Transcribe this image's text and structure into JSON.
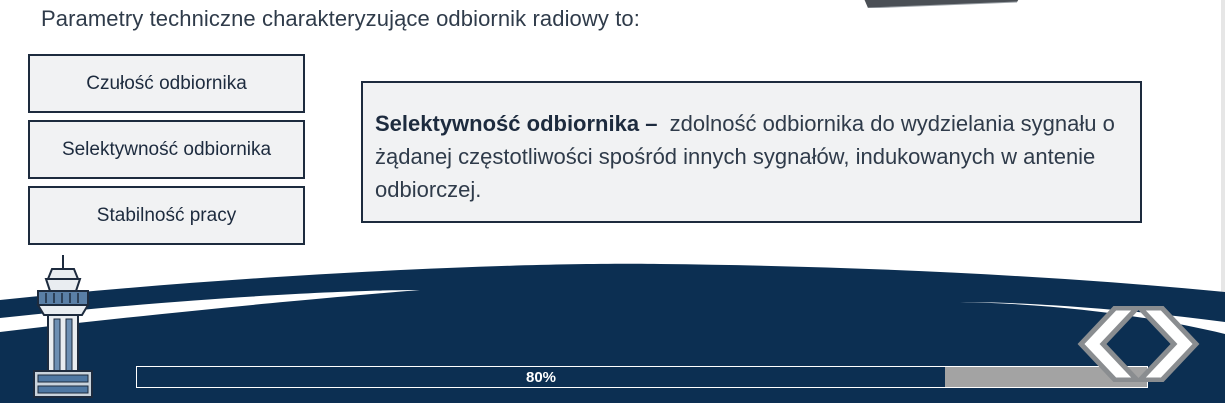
{
  "intro": {
    "text": "Parametry techniczne charakteryzujące odbiornik radiowy to:"
  },
  "options": [
    {
      "label": "Czułość odbiornika"
    },
    {
      "label": "Selektywność odbiornika"
    },
    {
      "label": "Stabilność pracy"
    }
  ],
  "selected_option": "Selektywność odbiornika",
  "description": {
    "term": "Selektywność odbiornika –",
    "text": "zdolność odbiornika do wydzielania sygnału o żądanej częstotliwości spośród innych sygnałów, indukowanych w antenie odbiorczej."
  },
  "progress": {
    "value": 0.8,
    "label": "80%"
  },
  "navigation": {
    "prev_icon": "chevron-left-icon",
    "next_icon": "chevron-right-icon"
  },
  "colors": {
    "navy": "#0c2f52",
    "border": "#1d2b3e",
    "panel": "#f1f2f3",
    "text": "#2f3b4a",
    "progress_track": "#a3a3a3"
  }
}
